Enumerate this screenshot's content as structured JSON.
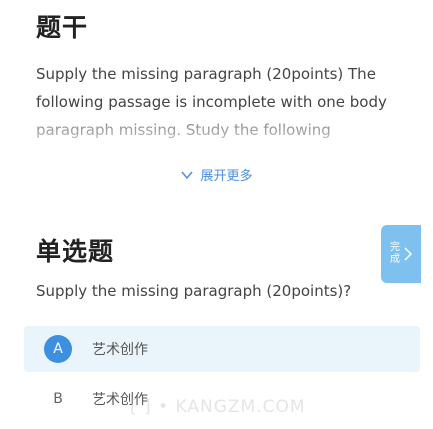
{
  "stem": {
    "title": "题干",
    "text": "Supply the missing paragraph (20points) The following passage is incomplete with one body paragraph missing. Study the following",
    "expand_label": "展开更多"
  },
  "question": {
    "title": "单选题",
    "text": "Supply the missing paragraph (20points)?",
    "options": [
      {
        "letter": "A",
        "label": "艺术创作",
        "selected": true
      },
      {
        "letter": "B",
        "label": "艺术创作",
        "selected": false
      }
    ]
  },
  "side_tab": {
    "label": "完成"
  },
  "watermark": "[ ] • KANGZM.COM",
  "colors": {
    "accent": "#3d8fe0",
    "selected_bg": "#eaf4fb",
    "tab_bg": "#7fc1ee"
  }
}
